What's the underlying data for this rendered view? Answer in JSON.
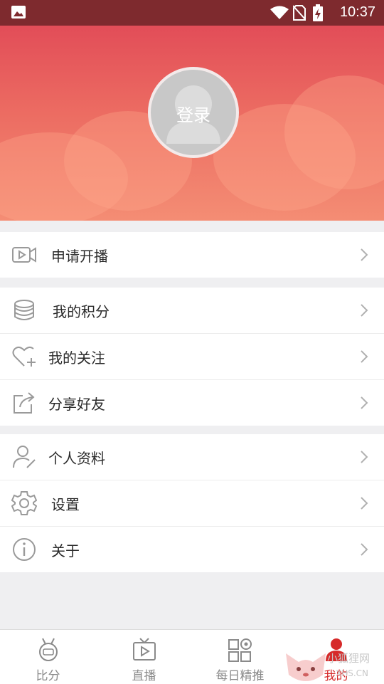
{
  "status_bar": {
    "time": "10:37"
  },
  "profile": {
    "login_label": "登录"
  },
  "menu_groups": [
    {
      "items": [
        {
          "label": "申请开播",
          "icon": "video-camera-icon"
        }
      ]
    },
    {
      "items": [
        {
          "label": "我的积分",
          "icon": "coin-stack-icon"
        },
        {
          "label": "我的关注",
          "icon": "heart-plus-icon"
        },
        {
          "label": "分享好友",
          "icon": "share-icon"
        }
      ]
    },
    {
      "items": [
        {
          "label": "个人资料",
          "icon": "user-edit-icon"
        },
        {
          "label": "设置",
          "icon": "gear-icon"
        },
        {
          "label": "关于",
          "icon": "info-icon"
        }
      ]
    }
  ],
  "tabs": [
    {
      "label": "比分",
      "icon": "score-medal-icon",
      "active": false
    },
    {
      "label": "直播",
      "icon": "tv-icon",
      "active": false
    },
    {
      "label": "每日精推",
      "icon": "daily-pick-icon",
      "active": false
    },
    {
      "label": "我的",
      "icon": "profile-icon",
      "active": true
    }
  ],
  "colors": {
    "header_top": "#e24d58",
    "header_bottom": "#f48d74",
    "status_bar": "#7e2a2e",
    "active_tab": "#d62a2a"
  }
}
